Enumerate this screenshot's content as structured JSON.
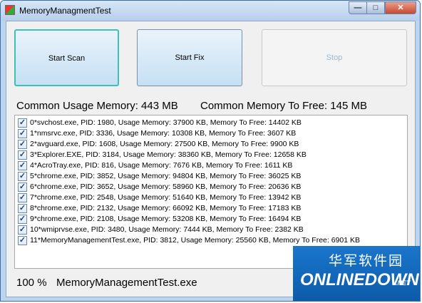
{
  "window": {
    "title": "MemoryManagmentTest"
  },
  "titlebar_buttons": {
    "minimize": "—",
    "maximize": "□",
    "close": "✕"
  },
  "buttons": {
    "start_scan": "Start Scan",
    "start_fix": "Start Fix",
    "stop": "Stop"
  },
  "summary": {
    "common_usage": "Common Usage Memory: 443 MB",
    "common_to_free": "Common Memory To Free: 145 MB"
  },
  "processes": [
    {
      "checked": true,
      "text": "0*svchost.exe, PID: 1980, Usage Memory: 37900 KB, Memory To Free: 14402 KB"
    },
    {
      "checked": true,
      "text": "1*nmsrvc.exe, PID: 3336, Usage Memory: 10308 KB, Memory To Free: 3607 KB"
    },
    {
      "checked": true,
      "text": "2*avguard.exe, PID: 1608, Usage Memory: 27500 KB, Memory To Free: 9900 KB"
    },
    {
      "checked": true,
      "text": "3*Explorer.EXE, PID: 3184, Usage Memory: 38360 KB, Memory To Free: 12658 KB"
    },
    {
      "checked": true,
      "text": "4*AcroTray.exe, PID: 816, Usage Memory: 7676 KB, Memory To Free: 1611 KB"
    },
    {
      "checked": true,
      "text": "5*chrome.exe, PID: 3852, Usage Memory: 94804 KB, Memory To Free: 36025 KB"
    },
    {
      "checked": true,
      "text": "6*chrome.exe, PID: 3652, Usage Memory: 58960 KB, Memory To Free: 20636 KB"
    },
    {
      "checked": true,
      "text": "7*chrome.exe, PID: 2548, Usage Memory: 51640 KB, Memory To Free: 13942 KB"
    },
    {
      "checked": true,
      "text": "8*chrome.exe, PID: 2132, Usage Memory: 66092 KB, Memory To Free: 17183 KB"
    },
    {
      "checked": true,
      "text": "9*chrome.exe, PID: 2108, Usage Memory: 53208 KB, Memory To Free: 16494 KB"
    },
    {
      "checked": true,
      "text": "10*wmiprvse.exe, PID: 3480, Usage Memory: 7444 KB, Memory To Free: 2382 KB"
    },
    {
      "checked": true,
      "text": "11*MemoryManagementTest.exe, PID: 3812, Usage Memory: 25560 KB, Memory To Free: 6901 KB"
    }
  ],
  "status": {
    "progress_text": "100 %",
    "current_file": "MemoryManagementTest.exe"
  },
  "watermark": {
    "chinese": "华军软件园",
    "logo": "ONLINEDOWN",
    "suffix": ".NET"
  },
  "colors": {
    "title_bg": "#c4d9f1",
    "client_bg": "#f0f0f0",
    "scan_focus": "#3cc0b8",
    "watermark_bg": "#1268bb"
  }
}
